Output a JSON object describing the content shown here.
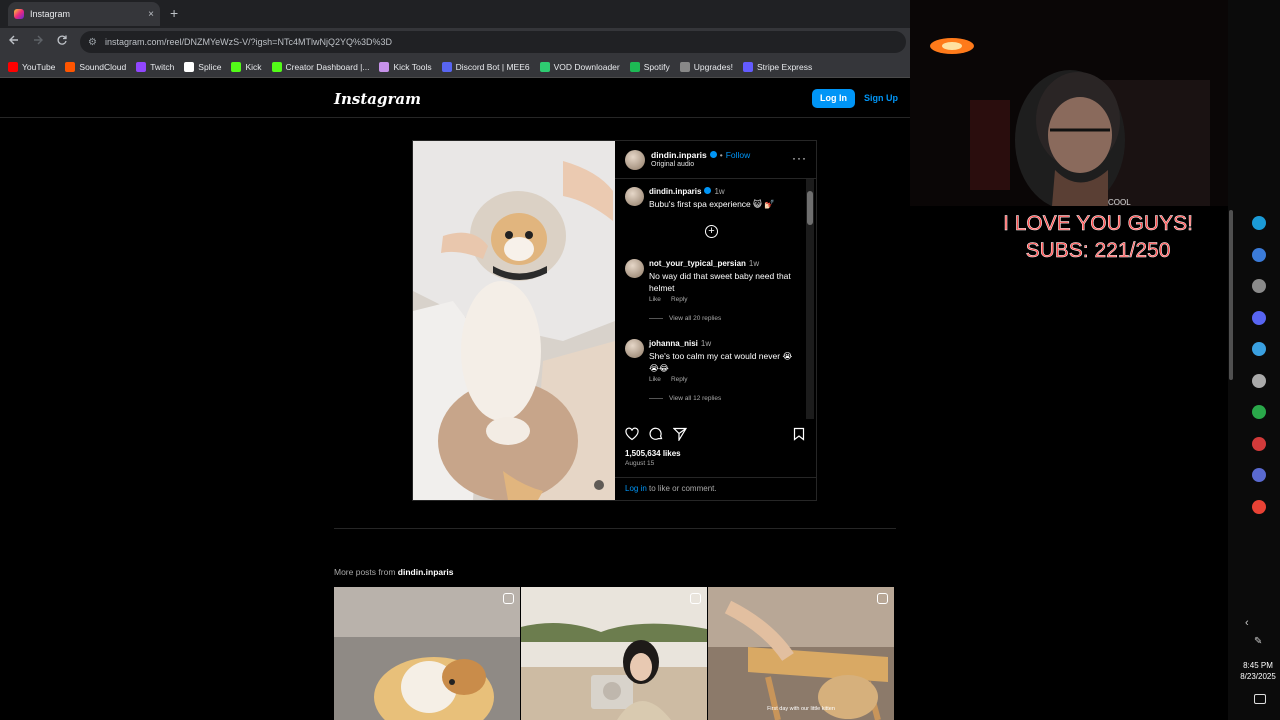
{
  "browser": {
    "tab_title": "Instagram",
    "tab_close": "×",
    "new_tab": "+",
    "url": "instagram.com/reel/DNZMYeWzS-V/?igsh=NTc4MTlwNjQ2YQ%3D%3D",
    "bookmarks": [
      {
        "label": "YouTube",
        "color": "#ff0000"
      },
      {
        "label": "SoundCloud",
        "color": "#ff5500"
      },
      {
        "label": "Twitch",
        "color": "#9146ff"
      },
      {
        "label": "Splice",
        "color": "#ffffff"
      },
      {
        "label": "Kick",
        "color": "#53fc18"
      },
      {
        "label": "Creator Dashboard |...",
        "color": "#53fc18"
      },
      {
        "label": "Kick Tools",
        "color": "#c792ea"
      },
      {
        "label": "Discord Bot | MEE6",
        "color": "#5865f2"
      },
      {
        "label": "VOD Downloader",
        "color": "#2ecc71"
      },
      {
        "label": "Spotify",
        "color": "#1db954"
      },
      {
        "label": "Upgrades!",
        "color": "#888888"
      },
      {
        "label": "Stripe Express",
        "color": "#635bff"
      }
    ]
  },
  "instagram": {
    "logo": "Instagram",
    "login_button": "Log In",
    "signup_link": "Sign Up",
    "post": {
      "username": "dindin.inparis",
      "dot": "•",
      "follow": "Follow",
      "audio": "Original audio",
      "more": "···",
      "add_glyph": "+",
      "caption": {
        "user": "dindin.inparis",
        "time": "1w",
        "text": "Bubu's first spa experience 😺 💅🏻"
      },
      "comments": [
        {
          "user": "not_your_typical_persian",
          "time": "1w",
          "text": "No way did that sweet baby need that helmet",
          "like": "Like",
          "reply": "Reply",
          "view_replies": "View all 20 replies"
        },
        {
          "user": "johanna_nisi",
          "time": "1w",
          "text": "She's too calm my cat would never 😭😭😂",
          "like": "Like",
          "reply": "Reply",
          "view_replies": "View all 12 replies"
        }
      ],
      "likes": "1,505,634 likes",
      "date": "August 15",
      "login_link": "Log in",
      "login_suffix": " to like or comment."
    },
    "more_posts_prefix": "More posts from ",
    "more_posts_user": "dindin.inparis",
    "thumb_caption": "First day with our little kitten"
  },
  "overlay": {
    "cam_text": "COOL",
    "line1": "I LOVE YOU GUYS!",
    "line2": "SUBS: 221/250"
  },
  "taskbar": {
    "time": "8:45 PM",
    "date": "8/23/2025",
    "icons": [
      "steam-icon",
      "edge-icon",
      "obs-icon",
      "discord-icon",
      "chrome-alt-icon",
      "explorer-icon",
      "xbox-icon",
      "app-icon",
      "app-grid-icon",
      "chrome-icon"
    ]
  }
}
